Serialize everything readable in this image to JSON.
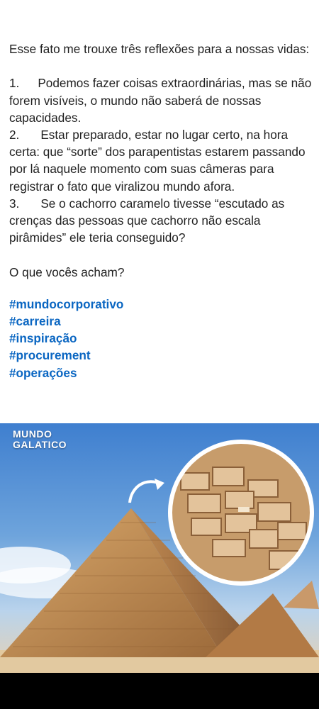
{
  "post": {
    "intro": "Esse fato me trouxe três  reflexões para a nossas vidas:",
    "items": [
      {
        "num": "1.",
        "text": "Podemos fazer coisas extraordinárias, mas se não forem visíveis, o mundo não saberá de nossas capacidades."
      },
      {
        "num": "2.",
        "text": "Estar preparado, estar no lugar certo, na hora certa: que “sorte” dos parapentistas estarem passando por lá naquele momento com suas câmeras para registrar o fato que viralizou  mundo afora."
      },
      {
        "num": "3.",
        "text": "Se o cachorro caramelo tivesse “escutado as crenças das pessoas que cachorro não escala pirâmides” ele teria conseguido?"
      }
    ],
    "question": "O que vocês acham?",
    "hashtags": [
      "#mundocorporativo",
      "#carreira",
      "#inspiração",
      "#procurement",
      "#operações"
    ]
  },
  "image": {
    "watermark_line1": "MUNDO",
    "watermark_line2": "GALATICO",
    "hashtag_color": "#0a66c2"
  }
}
